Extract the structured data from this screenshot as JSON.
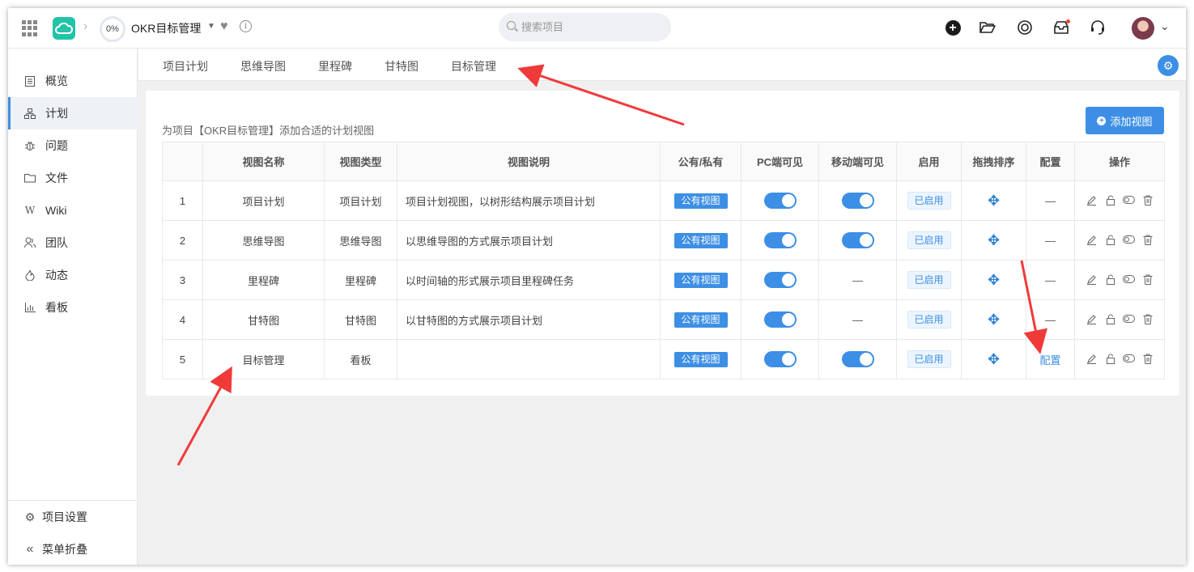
{
  "topbar": {
    "progress": "0%",
    "project_name": "OKR目标管理",
    "search_placeholder": "搜索项目"
  },
  "sidebar": {
    "items": [
      {
        "label": "概览",
        "icon": "overview-icon"
      },
      {
        "label": "计划",
        "icon": "plan-icon"
      },
      {
        "label": "问题",
        "icon": "bug-icon"
      },
      {
        "label": "文件",
        "icon": "folder-icon"
      },
      {
        "label": "Wiki",
        "icon": "wiki-icon"
      },
      {
        "label": "团队",
        "icon": "team-icon"
      },
      {
        "label": "动态",
        "icon": "activity-icon"
      },
      {
        "label": "看板",
        "icon": "kanban-icon"
      }
    ],
    "active": "计划",
    "settings_label": "项目设置",
    "collapse_label": "菜单折叠"
  },
  "tabs": [
    "项目计划",
    "思维导图",
    "里程碑",
    "甘特图",
    "目标管理"
  ],
  "content": {
    "description": "为项目【OKR目标管理】添加合适的计划视图",
    "add_button": "添加视图",
    "columns": [
      "",
      "视图名称",
      "视图类型",
      "视图说明",
      "公有/私有",
      "PC端可见",
      "移动端可见",
      "启用",
      "拖拽排序",
      "配置",
      "操作"
    ],
    "rows": [
      {
        "index": "1",
        "name": "项目计划",
        "type": "项目计划",
        "desc": "项目计划视图，以树形结构展示项目计划",
        "visibility": "公有视图",
        "pc": true,
        "mobile": true,
        "enabled": "已启用",
        "config": "—"
      },
      {
        "index": "2",
        "name": "思维导图",
        "type": "思维导图",
        "desc": "以思维导图的方式展示项目计划",
        "visibility": "公有视图",
        "pc": true,
        "mobile": true,
        "enabled": "已启用",
        "config": "—"
      },
      {
        "index": "3",
        "name": "里程碑",
        "type": "里程碑",
        "desc": "以时间轴的形式展示项目里程碑任务",
        "visibility": "公有视图",
        "pc": true,
        "mobile": false,
        "mobile_text": "—",
        "enabled": "已启用",
        "config": "—"
      },
      {
        "index": "4",
        "name": "甘特图",
        "type": "甘特图",
        "desc": "以甘特图的方式展示项目计划",
        "visibility": "公有视图",
        "pc": true,
        "mobile": false,
        "mobile_text": "—",
        "enabled": "已启用",
        "config": "—"
      },
      {
        "index": "5",
        "name": "目标管理",
        "type": "看板",
        "desc": "",
        "visibility": "公有视图",
        "pc": true,
        "mobile": true,
        "enabled": "已启用",
        "config": "配置"
      }
    ]
  },
  "colors": {
    "accent": "#3d8fe5",
    "annotation": "#f03a3a"
  }
}
